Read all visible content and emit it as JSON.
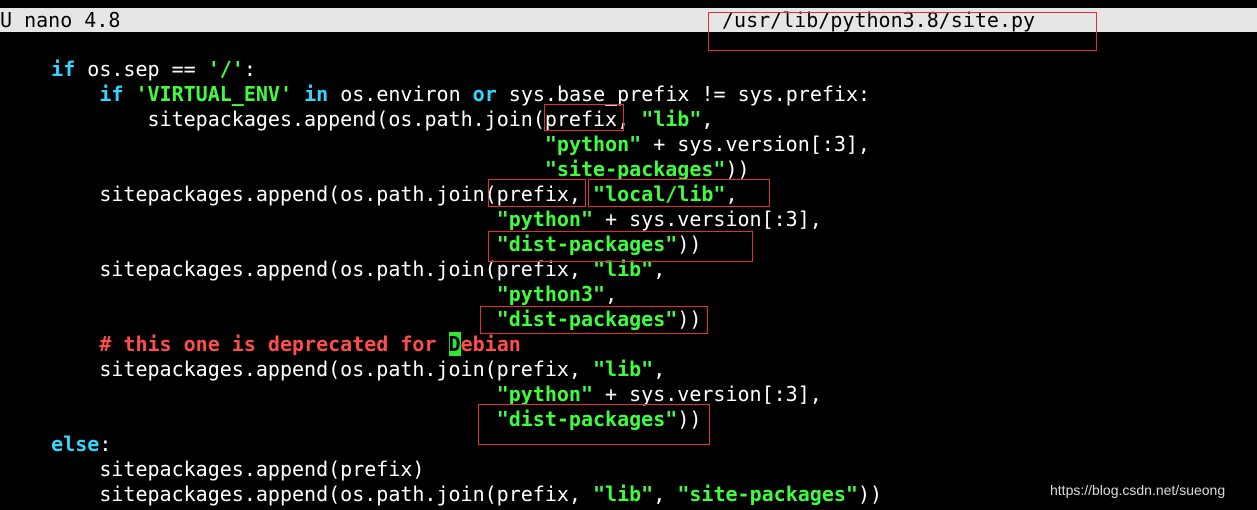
{
  "titlebar": {
    "app": "U nano 4.8",
    "file": "/usr/lib/python3.8/site.py"
  },
  "code": {
    "l1_kw": "if",
    "l1_a": " os.sep == ",
    "l1_str": "'/'",
    "l1_b": ":",
    "l2_kw1": "if",
    "l2_str": "'VIRTUAL_ENV'",
    "l2_kw2": "in",
    "l2_a": " os.environ ",
    "l2_kw3": "or",
    "l2_b": " sys.base_prefix != sys.prefix:",
    "l3_a": "sitepackages.append(os.path.join(prefix, ",
    "l3_str": "\"lib\"",
    "l3_b": ",",
    "l4_str": "\"python\"",
    "l4_b": " + sys.version[:3],",
    "l5_str": "\"site-packages\"",
    "l5_b": "))",
    "l6_a": "sitepackages.append(os.path.join(prefix, ",
    "l6_str": "\"local/lib\"",
    "l6_b": ",",
    "l7_str": "\"python\"",
    "l7_b": " + sys.version[:3],",
    "l8_str": "\"dist-packages\"",
    "l8_b": "))",
    "l9_a": "sitepackages.append(os.path.join(prefix, ",
    "l9_str": "\"lib\"",
    "l9_b": ",",
    "l10_str": "\"python3\"",
    "l10_b": ",",
    "l11_str": "\"dist-packages\"",
    "l11_b": "))",
    "l12_cmt": "# this one is deprecated for ",
    "l12_cursor": "D",
    "l12_cmt2": "ebian",
    "l13_a": "sitepackages.append(os.path.join(prefix, ",
    "l13_str": "\"lib\"",
    "l13_b": ",",
    "l14_str": "\"python\"",
    "l14_b": " + sys.version[:3],",
    "l15_str": "\"dist-packages\"",
    "l15_b": "))",
    "l16_kw": "else",
    "l16_b": ":",
    "l17_a": "sitepackages.append(prefix)",
    "l18_a": "sitepackages.append(os.path.join(prefix, ",
    "l18_str1": "\"lib\"",
    "l18_b": ", ",
    "l18_str2": "\"site-packages\"",
    "l18_c": "))"
  },
  "watermark": "https://blog.csdn.net/sueong",
  "colors": {
    "keyword": "#33d6ff",
    "string": "#3ffc3f",
    "comment": "#ff4d4d",
    "cursor": "#2ee82e",
    "highlight_box": "#e03030",
    "titlebar_bg": "#e6e6e6"
  }
}
